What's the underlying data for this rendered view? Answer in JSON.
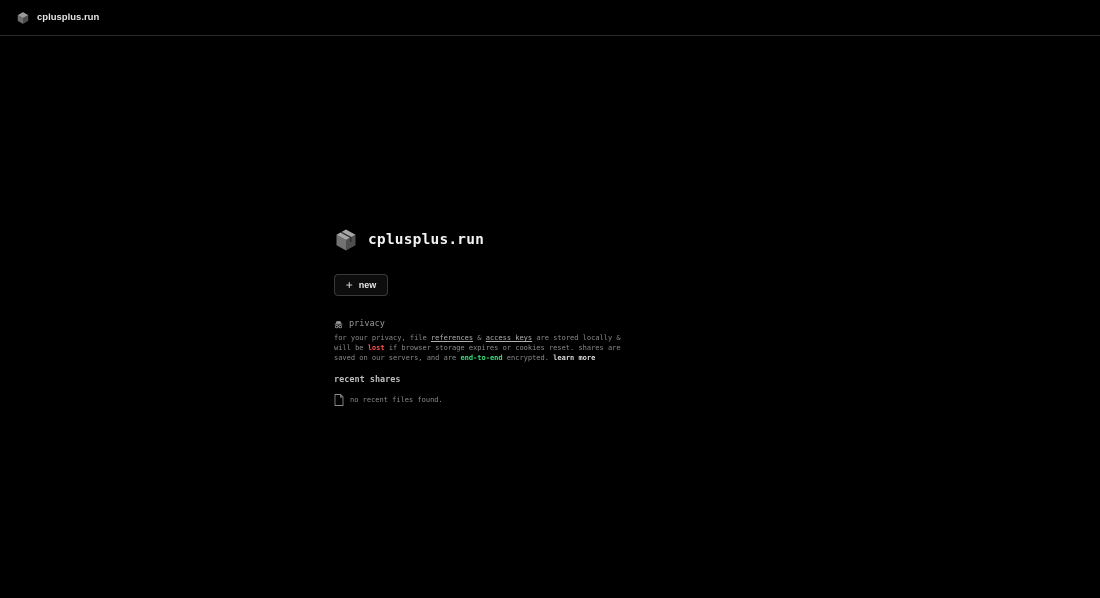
{
  "header": {
    "brand_name": "cplusplus.run",
    "logo_icon": "cube-icon"
  },
  "hero": {
    "title": "cplusplus.run",
    "logo_icon": "cube-icon"
  },
  "actions": {
    "new_label": "new",
    "new_icon": "plus-icon"
  },
  "privacy": {
    "heading": "privacy",
    "heading_icon": "incognito-icon",
    "text_1": "for your privacy, file ",
    "link_references": "references",
    "text_2": " & ",
    "link_access_keys": "access keys",
    "text_3": " are stored locally & will be ",
    "lost": "lost",
    "text_4": " if browser storage expires or cookies reset. shares are saved on our servers, and are ",
    "e2e": "end-to-end",
    "text_5": " encrypted. ",
    "learn_more": "learn more"
  },
  "recent": {
    "title": "recent shares",
    "empty_message": "no recent files found.",
    "empty_icon": "file-icon"
  },
  "colors": {
    "background": "#000000",
    "lost": "#ff4d4d",
    "e2e": "#39e07a",
    "border": "#2a2a2a"
  }
}
